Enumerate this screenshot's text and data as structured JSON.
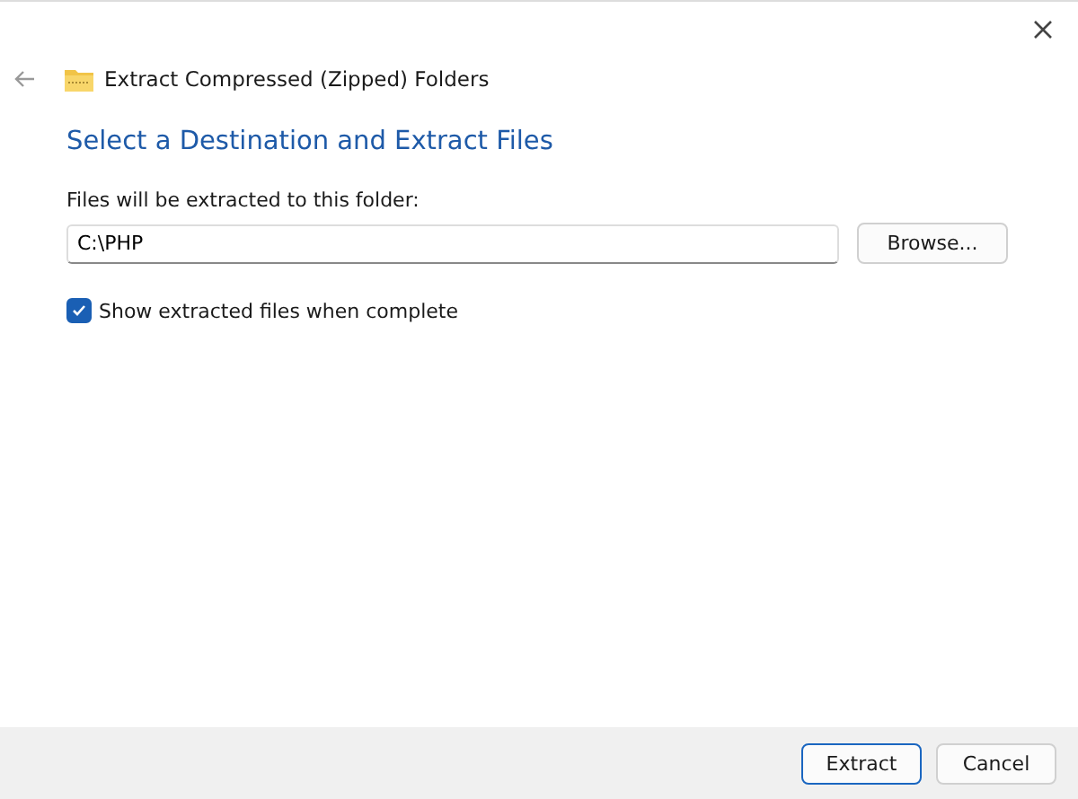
{
  "window": {
    "title": "Extract Compressed (Zipped) Folders"
  },
  "heading": "Select a Destination and Extract Files",
  "destination": {
    "label": "Files will be extracted to this folder:",
    "value": "C:\\PHP",
    "browse_button": "Browse..."
  },
  "show_files": {
    "label": "Show extracted files when complete",
    "checked": true
  },
  "buttons": [
    {
      "label": "Extract",
      "default": true
    },
    {
      "label": "Cancel",
      "default": false
    }
  ]
}
